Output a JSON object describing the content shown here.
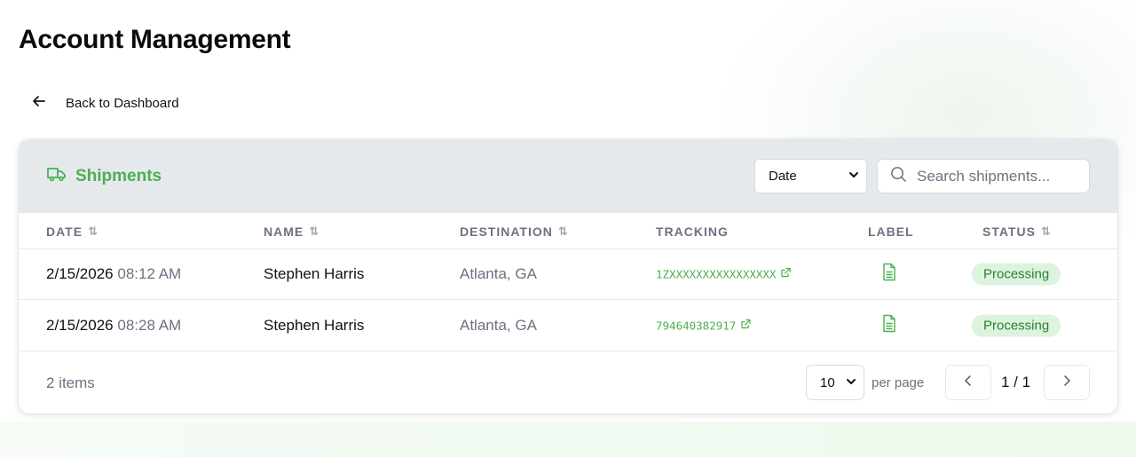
{
  "page": {
    "title": "Account Management"
  },
  "back_link": {
    "label": "Back to Dashboard"
  },
  "card": {
    "title": "Shipments",
    "sort_select": {
      "value": "Date"
    },
    "search": {
      "placeholder": "Search shipments..."
    }
  },
  "table": {
    "headers": {
      "date": "DATE",
      "name": "NAME",
      "destination": "DESTINATION",
      "tracking": "TRACKING",
      "label": "LABEL",
      "status": "STATUS"
    },
    "rows": [
      {
        "date": "2/15/2026",
        "time": "08:12 AM",
        "name": "Stephen Harris",
        "destination": "Atlanta, GA",
        "tracking": "1ZXXXXXXXXXXXXXXXX",
        "status": "Processing"
      },
      {
        "date": "2/15/2026",
        "time": "08:28 AM",
        "name": "Stephen Harris",
        "destination": "Atlanta, GA",
        "tracking": "794640382917",
        "status": "Processing"
      }
    ]
  },
  "pagination": {
    "items_count": "2 items",
    "per_page_value": "10",
    "per_page_label": "per page",
    "page_indicator": "1 / 1"
  },
  "colors": {
    "accent": "#4caf50",
    "badge_bg": "#dcf3de",
    "header_bg": "#e6e9ec"
  }
}
